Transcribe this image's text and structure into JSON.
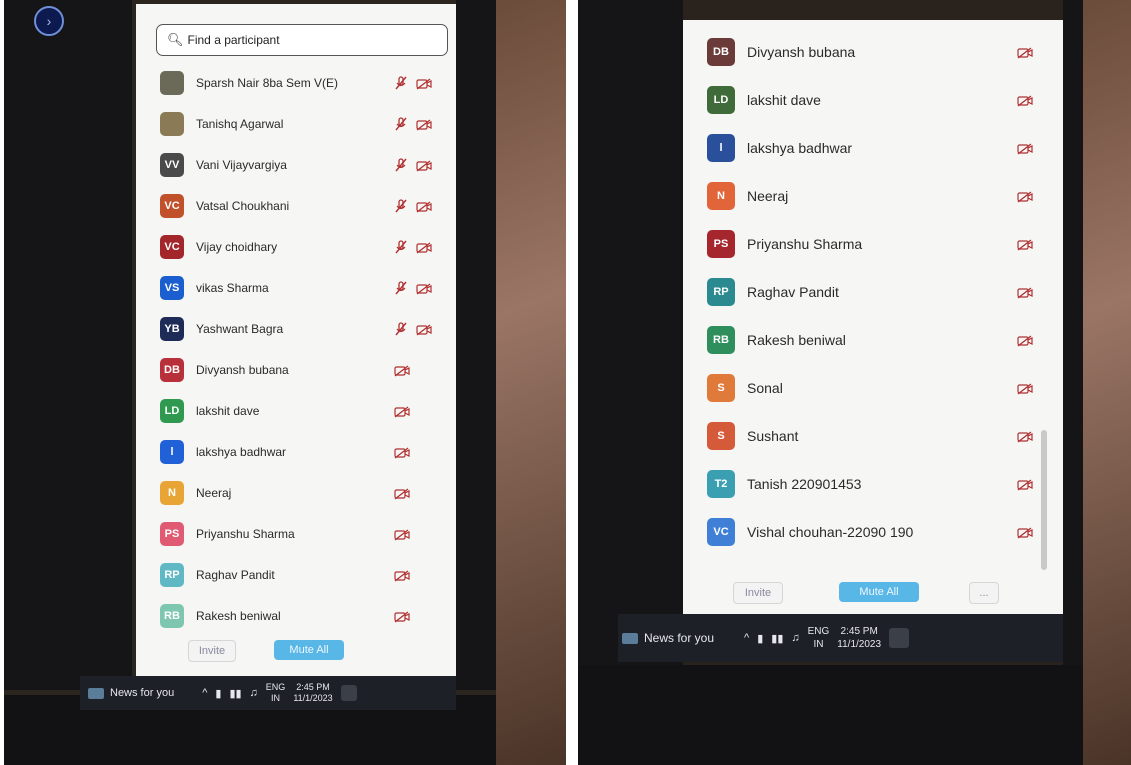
{
  "left": {
    "search": {
      "placeholder": "Find a participant"
    },
    "participants": [
      {
        "name": "Sparsh Nair 8ba Sem V(E)",
        "initials": "",
        "color": "#6b6a58",
        "mic_off": true
      },
      {
        "name": "Tanishq Agarwal",
        "initials": "",
        "color": "#8a7a55",
        "mic_off": true
      },
      {
        "name": "Vani Vijayvargiya",
        "initials": "VV",
        "color": "#4a4a4a",
        "mic_off": true
      },
      {
        "name": "Vatsal Choukhani",
        "initials": "VC",
        "color": "#c0512a",
        "mic_off": true
      },
      {
        "name": "Vijay choidhary",
        "initials": "VC",
        "color": "#a3262a",
        "mic_off": true
      },
      {
        "name": "vikas Sharma",
        "initials": "VS",
        "color": "#1a5ed0",
        "mic_off": true
      },
      {
        "name": "Yashwant Bagra",
        "initials": "YB",
        "color": "#1e2b57",
        "mic_off": true
      },
      {
        "name": "Divyansh bubana",
        "initials": "DB",
        "color": "#b8303a",
        "mic_off": false
      },
      {
        "name": "lakshit dave",
        "initials": "LD",
        "color": "#2f9a4f",
        "mic_off": false
      },
      {
        "name": "lakshya badhwar",
        "initials": "l",
        "color": "#2161d8",
        "mic_off": false
      },
      {
        "name": "Neeraj",
        "initials": "N",
        "color": "#e8a535",
        "mic_off": false
      },
      {
        "name": "Priyanshu Sharma",
        "initials": "PS",
        "color": "#e05a74",
        "mic_off": false
      },
      {
        "name": "Raghav Pandit",
        "initials": "RP",
        "color": "#5fb8c4",
        "mic_off": false
      },
      {
        "name": "Rakesh beniwal",
        "initials": "RB",
        "color": "#7fc6b0",
        "mic_off": false
      }
    ],
    "invite_label": "Invite",
    "mute_all_label": "Mute All",
    "taskbar": {
      "news": "News for you",
      "lang1": "ENG",
      "lang2": "IN",
      "time": "2:45 PM",
      "date": "11/1/2023"
    }
  },
  "right": {
    "participants": [
      {
        "name": "Divyansh bubana",
        "initials": "DB",
        "color": "#6a3b38"
      },
      {
        "name": "lakshit dave",
        "initials": "LD",
        "color": "#3f6a3a"
      },
      {
        "name": "lakshya badhwar",
        "initials": "l",
        "color": "#2a4f9b"
      },
      {
        "name": "Neeraj",
        "initials": "N",
        "color": "#e2653a"
      },
      {
        "name": "Priyanshu Sharma",
        "initials": "PS",
        "color": "#a6262e"
      },
      {
        "name": "Raghav Pandit",
        "initials": "RP",
        "color": "#2b8a90"
      },
      {
        "name": "Rakesh beniwal",
        "initials": "RB",
        "color": "#2f8f5c"
      },
      {
        "name": "Sonal",
        "initials": "S",
        "color": "#e07a3a"
      },
      {
        "name": "Sushant",
        "initials": "S",
        "color": "#d45a3a"
      },
      {
        "name": "Tanish 220901453",
        "initials": "T2",
        "color": "#3a9fb0"
      },
      {
        "name": "Vishal chouhan-22090 190",
        "initials": "VC",
        "color": "#3f80d6"
      }
    ],
    "invite_label": "Invite",
    "mute_all_label": "Mute All",
    "more_label": "...",
    "taskbar": {
      "news": "News for you",
      "lang1": "ENG",
      "lang2": "IN",
      "time": "2:45 PM",
      "date": "11/1/2023"
    }
  }
}
